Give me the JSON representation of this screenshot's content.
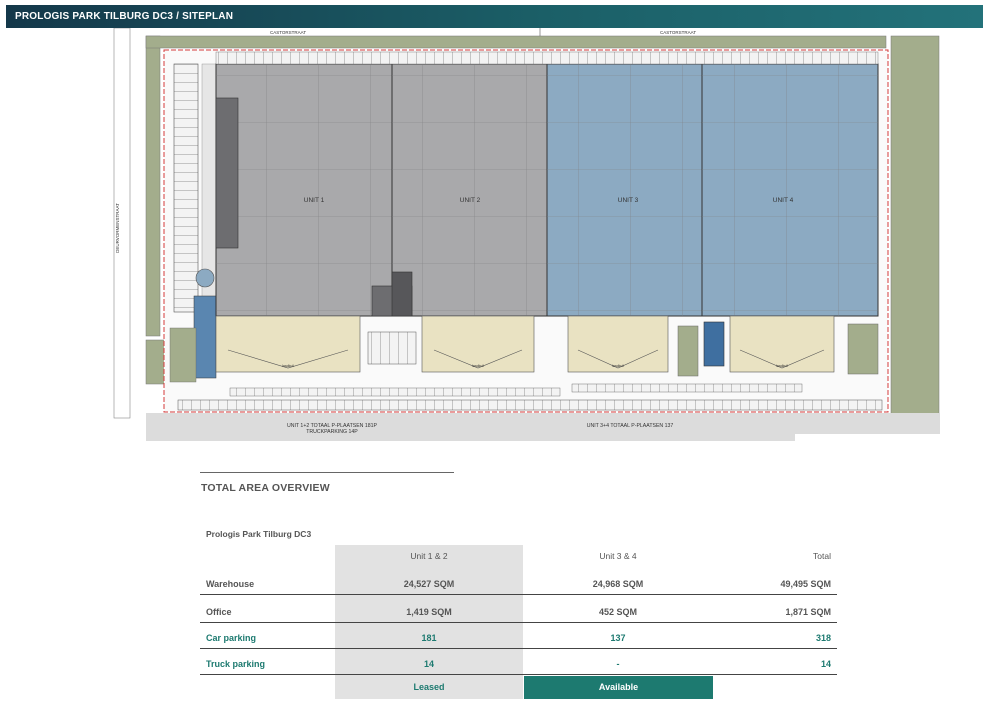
{
  "header": {
    "title": "PROLOGIS PARK TILBURG DC3 / SITEPLAN"
  },
  "siteplan": {
    "streets": {
      "north_left": "CASTORSTRAAT",
      "north_right": "CASTORSTRAAT",
      "west": "DEURVORMENSTRAAT"
    },
    "units": [
      "UNIT 1",
      "UNIT 2",
      "UNIT 3",
      "UNIT 4"
    ],
    "dock_label": "laadkuil",
    "parking_left": [
      "UNIT 1+2 TOTAAL  P-PLAATSEN 181P",
      "TRUCKPARKING  14P"
    ],
    "parking_right": "UNIT 3+4 TOTAAL  P-PLAATSEN 137",
    "colors": {
      "leased_unit": "#a9a9ab",
      "available_unit": "#8caac2",
      "dock_area": "#e9e2c2",
      "green": "#a3ad8c",
      "site_line": "#d43b3b"
    }
  },
  "overview": {
    "title": "TOTAL AREA OVERVIEW",
    "caption": "Prologis Park Tilburg DC3",
    "columns": [
      "Unit 1 & 2",
      "Unit 3 & 4",
      "Total"
    ],
    "rows": [
      {
        "label": "Warehouse",
        "values": [
          "24,527 SQM",
          "24,968 SQM",
          "49,495 SQM"
        ],
        "accent": false
      },
      {
        "label": "Office",
        "values": [
          "1,419 SQM",
          "452 SQM",
          "1,871 SQM"
        ],
        "accent": false
      },
      {
        "label": "Car parking",
        "values": [
          "181",
          "137",
          "318"
        ],
        "accent": true
      },
      {
        "label": "Truck parking",
        "values": [
          "14",
          "-",
          "14"
        ],
        "accent": true
      }
    ],
    "status": {
      "unit12": "Leased",
      "unit34": "Available"
    },
    "colors": {
      "accent": "#1d7a70",
      "highlight_column": "#e2e2e2"
    }
  }
}
